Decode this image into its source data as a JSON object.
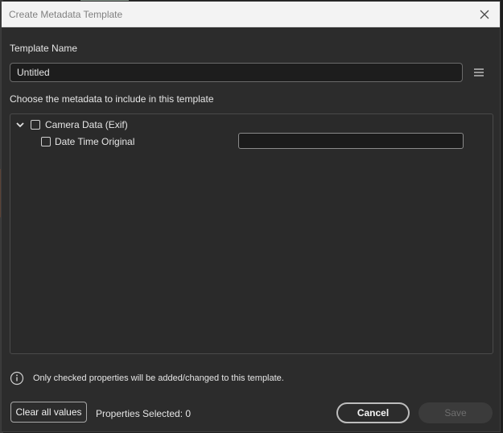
{
  "window": {
    "title": "Create Metadata Template",
    "close_icon": "close-icon"
  },
  "template_name": {
    "label": "Template Name",
    "value": "Untitled",
    "menu_icon": "hamburger-menu-icon"
  },
  "metadata_section": {
    "label": "Choose the metadata to include in this template",
    "tree": {
      "group": {
        "label": "Camera Data (Exif)",
        "expanded": true,
        "checked": false
      },
      "items": [
        {
          "label": "Date Time Original",
          "checked": false,
          "value": ""
        }
      ]
    }
  },
  "info": {
    "icon": "info-icon",
    "text": "Only checked properties will be added/changed to this template."
  },
  "footer": {
    "clear_label": "Clear all values",
    "properties_selected": "Properties Selected: 0",
    "cancel_label": "Cancel",
    "save_label": "Save",
    "save_enabled": false
  },
  "colors": {
    "dialog_bg": "#2c2c2c",
    "titlebar_bg": "#f3f3f3",
    "field_bg": "#1d1d1d",
    "text": "#e6e6e6",
    "disabled_text": "#6e6e6e"
  }
}
